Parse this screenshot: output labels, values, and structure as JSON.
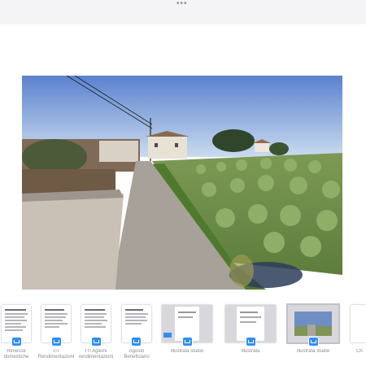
{
  "window": {
    "menu_icon": "more-dots-icon"
  },
  "viewer": {
    "description_none": ""
  },
  "thumbnails": [
    {
      "type": "doc",
      "caption": "Rimesse\ndomestiche",
      "badge_icon": "mail-icon"
    },
    {
      "type": "doc",
      "caption": "ITI\nRendimentazioni",
      "badge_icon": "mail-icon"
    },
    {
      "type": "doc",
      "caption": "ITI Aglioni\nrendimentazioni",
      "badge_icon": "mail-icon"
    },
    {
      "type": "doc",
      "caption": "Agosto\nBeneficiario",
      "badge_icon": "mail-icon"
    },
    {
      "type": "shot",
      "caption": "Illustrata studio",
      "badge_icon": "mail-icon"
    },
    {
      "type": "shot",
      "caption": "Illustrata",
      "badge_icon": "mail-icon"
    },
    {
      "type": "shot",
      "caption": "Illustrata studio",
      "badge_icon": "mail-icon"
    },
    {
      "type": "doc",
      "caption": "Ch",
      "badge_icon": "mail-icon"
    }
  ]
}
